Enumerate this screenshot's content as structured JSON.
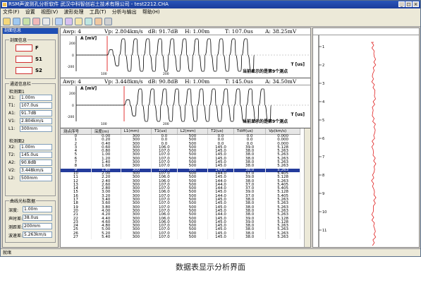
{
  "window": {
    "title": "RSM声波测孔分析软件    武汉中科智创岩土技术有限公司  - test2212.CHA"
  },
  "menu": [
    "文件(F)",
    "设置",
    "视图(V)",
    "波形处理",
    "工具(T)",
    "分析与输出",
    "帮助(H)"
  ],
  "left_panel": {
    "header": "剖面信息",
    "section_title": "剖面信息",
    "signals": [
      "F",
      "S1",
      "S2"
    ],
    "channel_group": "通道信息栏",
    "ch1_title": "检测面1",
    "ch1_fields": [
      {
        "label": "X1:",
        "value": "1.00m"
      },
      {
        "label": "T1:",
        "value": "107.0us"
      },
      {
        "label": "A1:",
        "value": "91.7dB"
      },
      {
        "label": "V1:",
        "value": "2.804km/s"
      },
      {
        "label": "L1:",
        "value": "300mm"
      }
    ],
    "ch2_title": "检测面2",
    "ch2_fields": [
      {
        "label": "X2:",
        "value": "1.00m"
      },
      {
        "label": "T2:",
        "value": "145.0us"
      },
      {
        "label": "A2:",
        "value": "90.8dB"
      },
      {
        "label": "V2:",
        "value": "3.448km/s"
      },
      {
        "label": "L2:",
        "value": "500mm"
      }
    ],
    "curve_title": "曲线光标数据",
    "curve_fields": [
      {
        "label": "深度:",
        "value": "1.00m"
      },
      {
        "label": "声时差:",
        "value": "38.0us"
      },
      {
        "label": "测距差:",
        "value": "200mm"
      },
      {
        "label": "波速差:",
        "value": "5.263km/s"
      }
    ]
  },
  "wave1": {
    "amp": "Awp: 4",
    "vp": "Vp: 2.804km/s",
    "db": "dB: 91.7dB",
    "h": "H: 1.00m",
    "t": "T: 107.0us",
    "a": "A: 38.25mV",
    "ylabel": "A [mV]",
    "xlabel": "T [us]",
    "note": "当前显示的是第9个测点",
    "yticks": [
      "200",
      "0",
      "-200"
    ],
    "xticks": [
      "100",
      "200"
    ]
  },
  "wave2": {
    "amp": "Awp: 4",
    "vp": "Vp: 3.448km/s",
    "db": "dB: 90.8dB",
    "h": "H: 1.00m",
    "t": "T: 145.0us",
    "a": "A: 34.50mV",
    "ylabel": "A [mV]",
    "xlabel": "T [us]",
    "note": "当前显示的是第9个测点",
    "yticks": [
      "200",
      "0",
      "-200"
    ],
    "xticks": [
      "100",
      "200"
    ]
  },
  "table": {
    "columns": [
      "测点序号",
      "深度(m)",
      "L1(mm)",
      "T1(us)",
      "L2(mm)",
      "T2(us)",
      "Tdiff(us)",
      "Vp(km/s)"
    ],
    "selected_index": 9,
    "rows": [
      [
        "0",
        "0.00",
        "300",
        "0.0",
        "500",
        "0.0",
        "0.0",
        "0.000"
      ],
      [
        "1",
        "0.20",
        "300",
        "0.0",
        "500",
        "0.0",
        "0.0",
        "0.000"
      ],
      [
        "2",
        "0.40",
        "300",
        "0.0",
        "500",
        "0.0",
        "0.0",
        "0.000"
      ],
      [
        "3",
        "0.60",
        "300",
        "106.0",
        "500",
        "145.0",
        "39.0",
        "5.128"
      ],
      [
        "4",
        "0.80",
        "300",
        "107.0",
        "500",
        "145.0",
        "38.0",
        "5.263"
      ],
      [
        "5",
        "1.00",
        "300",
        "107.0",
        "500",
        "145.0",
        "38.0",
        "5.263"
      ],
      [
        "6",
        "1.20",
        "300",
        "107.0",
        "500",
        "145.0",
        "38.0",
        "5.263"
      ],
      [
        "7",
        "1.40",
        "300",
        "107.0",
        "500",
        "145.0",
        "38.0",
        "5.263"
      ],
      [
        "8",
        "1.60",
        "300",
        "107.0",
        "500",
        "145.0",
        "38.0",
        "5.263"
      ],
      [
        "9",
        "1.80",
        "300",
        "107.0",
        "500",
        "145.0",
        "38.0",
        "5.263"
      ],
      [
        "10",
        "2.00",
        "300",
        "107.0",
        "500",
        "144.0",
        "37.0",
        "5.405"
      ],
      [
        "11",
        "2.20",
        "300",
        "106.0",
        "500",
        "145.0",
        "39.0",
        "5.128"
      ],
      [
        "12",
        "2.40",
        "300",
        "106.0",
        "500",
        "144.0",
        "38.0",
        "5.263"
      ],
      [
        "13",
        "2.60",
        "300",
        "107.0",
        "500",
        "144.0",
        "37.0",
        "5.405"
      ],
      [
        "14",
        "2.80",
        "300",
        "107.0",
        "500",
        "144.0",
        "37.0",
        "5.405"
      ],
      [
        "15",
        "3.00",
        "300",
        "106.0",
        "500",
        "145.0",
        "39.0",
        "5.128"
      ],
      [
        "16",
        "3.20",
        "300",
        "107.0",
        "500",
        "144.0",
        "37.0",
        "5.405"
      ],
      [
        "17",
        "3.40",
        "300",
        "107.0",
        "500",
        "145.0",
        "38.0",
        "5.263"
      ],
      [
        "18",
        "3.60",
        "300",
        "107.0",
        "500",
        "145.0",
        "38.0",
        "5.263"
      ],
      [
        "19",
        "3.80",
        "300",
        "107.0",
        "500",
        "145.0",
        "38.0",
        "5.263"
      ],
      [
        "20",
        "4.00",
        "300",
        "107.0",
        "500",
        "145.0",
        "38.0",
        "5.263"
      ],
      [
        "21",
        "4.20",
        "300",
        "106.0",
        "500",
        "144.0",
        "38.0",
        "5.263"
      ],
      [
        "22",
        "4.40",
        "300",
        "106.0",
        "500",
        "145.0",
        "39.0",
        "5.128"
      ],
      [
        "23",
        "4.60",
        "300",
        "106.0",
        "500",
        "145.0",
        "39.0",
        "5.128"
      ],
      [
        "24",
        "4.80",
        "300",
        "107.0",
        "500",
        "145.0",
        "38.0",
        "5.263"
      ],
      [
        "25",
        "5.00",
        "300",
        "107.0",
        "500",
        "145.0",
        "38.0",
        "5.263"
      ],
      [
        "26",
        "5.20",
        "300",
        "107.0",
        "500",
        "145.0",
        "38.0",
        "5.263"
      ],
      [
        "27",
        "5.40",
        "300",
        "107.0",
        "500",
        "145.0",
        "38.0",
        "5.263"
      ]
    ]
  },
  "right_panel": {
    "depth_ticks": [
      "1",
      "2",
      "3",
      "4",
      "5",
      "6",
      "7",
      "8",
      "9",
      "10",
      "11"
    ]
  },
  "status": "就绪",
  "caption": "数据表显示分析界面",
  "colors": {
    "accent": "#1f4fb5",
    "cursor": "#e02020",
    "selected_row": "#243c9c"
  }
}
